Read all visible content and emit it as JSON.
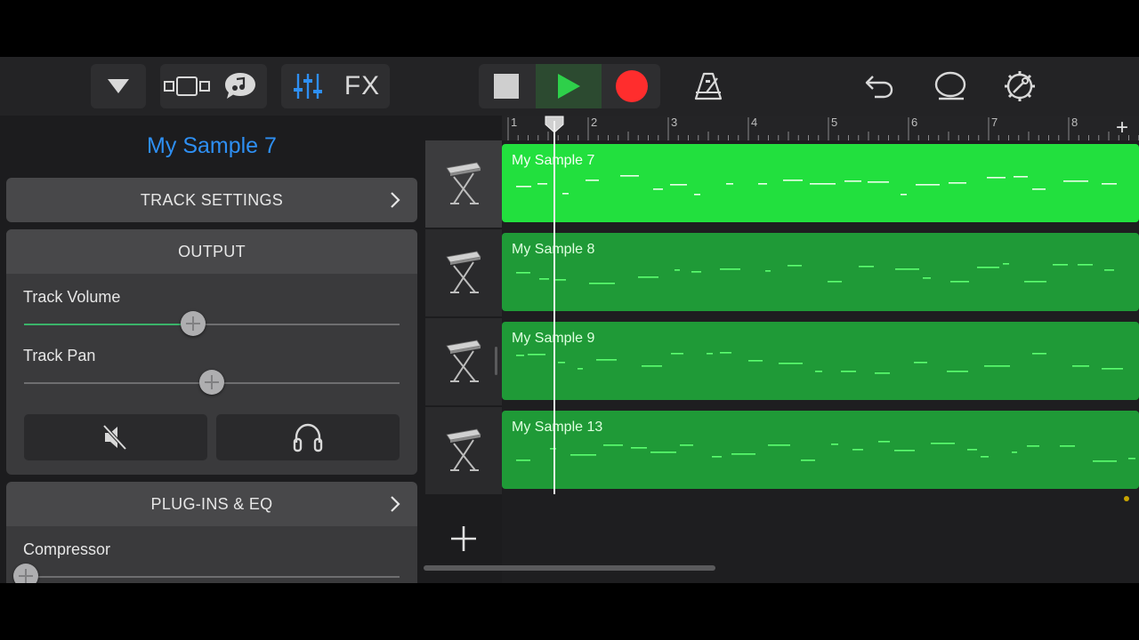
{
  "panel": {
    "track_title": "My Sample 7",
    "track_settings_label": "TRACK SETTINGS",
    "output_label": "OUTPUT",
    "track_volume_label": "Track Volume",
    "track_volume_value": 0.45,
    "track_pan_label": "Track Pan",
    "track_pan_value": 0.5,
    "plugins_label": "PLUG-INS & EQ",
    "compressor_label": "Compressor",
    "compressor_value": 0.0
  },
  "toolbar": {
    "fx_label": "FX"
  },
  "ruler": {
    "bars": [
      "1",
      "2",
      "3",
      "4",
      "5",
      "6",
      "7",
      "8"
    ],
    "add_label": "+"
  },
  "tracks": [
    {
      "name": "My Sample 7",
      "selected": true
    },
    {
      "name": "My Sample 8",
      "selected": false
    },
    {
      "name": "My Sample 9",
      "selected": false
    },
    {
      "name": "My Sample 13",
      "selected": false
    }
  ],
  "colors": {
    "accent_blue": "#2e8ff3",
    "region_selected": "#22e03e",
    "region": "#1f9a37",
    "record": "#ff2d2d",
    "play": "#2ed04a"
  }
}
